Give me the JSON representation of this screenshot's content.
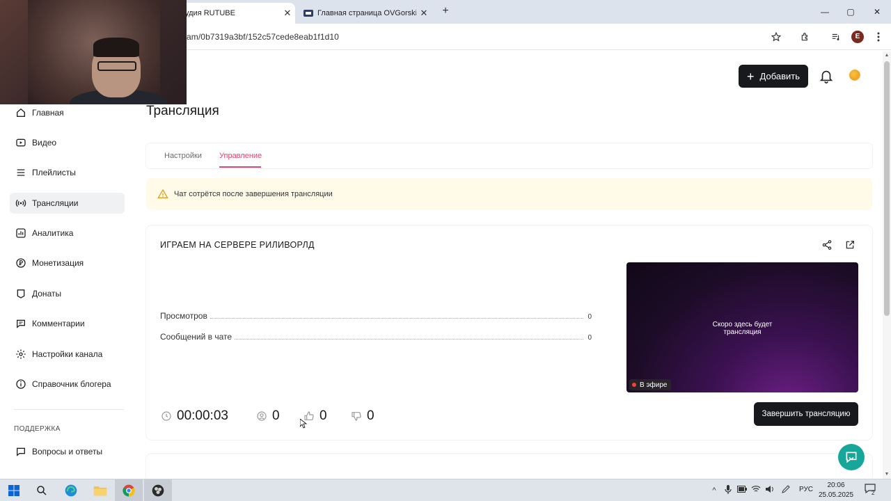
{
  "browser": {
    "tabs": [
      {
        "title": "удия RUTUBE",
        "close": "✕"
      },
      {
        "title": "Главная страница OVGorskiy",
        "close": "✕"
      }
    ],
    "new_tab": "+",
    "url": "am/0b7319a3bf/152c57cede8eab1f1d10",
    "profile_initial": "E",
    "window_controls": {
      "minimize": "—",
      "maximize": "▢",
      "close": "✕"
    }
  },
  "header": {
    "add_button": "Добавить"
  },
  "sidebar": {
    "items": [
      {
        "label": "Главная",
        "icon": "home-icon"
      },
      {
        "label": "Видео",
        "icon": "video-icon"
      },
      {
        "label": "Плейлисты",
        "icon": "playlist-icon"
      },
      {
        "label": "Трансляции",
        "icon": "broadcast-icon",
        "active": true
      },
      {
        "label": "Аналитика",
        "icon": "analytics-icon"
      },
      {
        "label": "Монетизация",
        "icon": "ruble-icon"
      },
      {
        "label": "Донаты",
        "icon": "donate-icon"
      },
      {
        "label": "Комментарии",
        "icon": "comment-icon"
      },
      {
        "label": "Настройки канала",
        "icon": "gear-icon"
      },
      {
        "label": "Справочник блогера",
        "icon": "info-icon"
      }
    ],
    "support_section": "ПОДДЕРЖКА",
    "support_items": [
      {
        "label": "Вопросы и ответы",
        "icon": "faq-icon"
      }
    ]
  },
  "main": {
    "page_title": "Трансляция",
    "tabs": [
      {
        "label": "Настройки"
      },
      {
        "label": "Управление",
        "selected": true
      }
    ],
    "alert": "Чат сотрётся после завершения трансляции",
    "stream": {
      "title": "ИГРАЕМ НА СЕРВЕРЕ РИЛИВОРЛД",
      "stats": [
        {
          "label": "Просмотров",
          "value": "0"
        },
        {
          "label": "Сообщений в чате",
          "value": "0"
        }
      ],
      "preview_text_line1": "Скоро здесь будет",
      "preview_text_line2": "трансляция",
      "live_badge": "В эфире",
      "duration": "00:00:03",
      "viewers": "0",
      "likes": "0",
      "dislikes": "0",
      "end_button": "Завершить трансляцию"
    }
  },
  "taskbar": {
    "language": "РУС",
    "time": "20:06",
    "date": "25.05.2025",
    "notifications": "2"
  },
  "colors": {
    "accent": "#e0446a",
    "dark_button": "#17191d",
    "alert_bg": "#fffbe8",
    "support_fab": "#16a79a"
  }
}
